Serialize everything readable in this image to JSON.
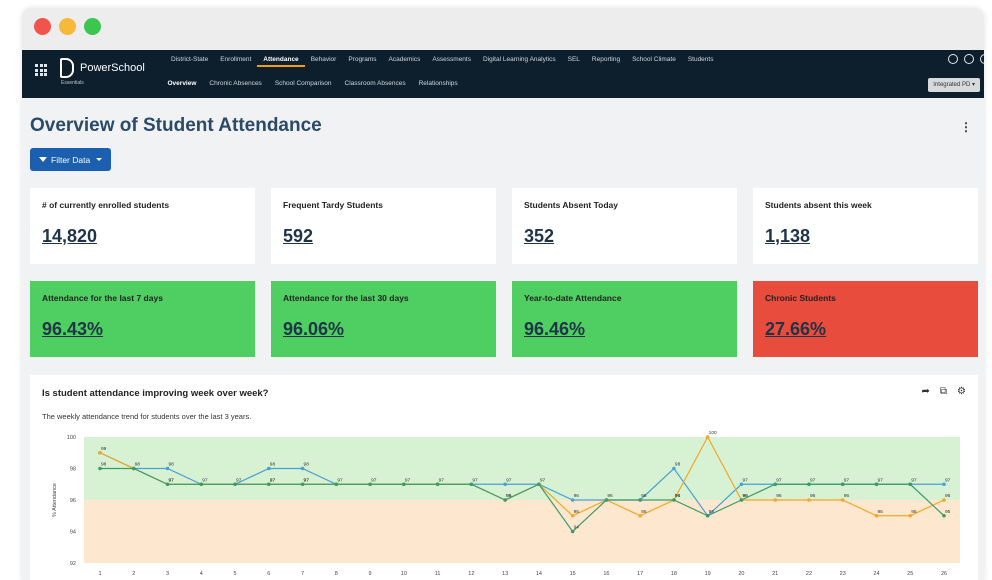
{
  "window": {
    "controls": [
      "close",
      "minimize",
      "maximize"
    ]
  },
  "brand": {
    "name": "PowerSchool",
    "sub": "Essentials"
  },
  "topnav": [
    "District-State",
    "Enrollment",
    "Attendance",
    "Behavior",
    "Programs",
    "Academics",
    "Assessments",
    "Digital Learning Analytics",
    "SEL",
    "Reporting",
    "School Climate",
    "Students"
  ],
  "topnav_active": "Attendance",
  "subnav": [
    "Overview",
    "Chronic Absences",
    "School Comparison",
    "Classroom Absences",
    "Relationships"
  ],
  "subnav_active": "Overview",
  "district_select": "Integrated PD ▾",
  "page": {
    "title": "Overview of Student Attendance",
    "filter_label": "Filter Data"
  },
  "stats": [
    {
      "label": "# of currently enrolled students",
      "value": "14,820"
    },
    {
      "label": "Frequent Tardy Students",
      "value": "592"
    },
    {
      "label": "Students Absent Today",
      "value": "352"
    },
    {
      "label": "Students absent this week",
      "value": "1,138"
    }
  ],
  "rates": [
    {
      "label": "Attendance for the last 7 days",
      "value": "96.43%",
      "status": "green"
    },
    {
      "label": "Attendance for the last 30 days",
      "value": "96.06%",
      "status": "green"
    },
    {
      "label": "Year-to-date Attendance",
      "value": "96.46%",
      "status": "green"
    },
    {
      "label": "Chronic Students",
      "value": "27.66%",
      "status": "red"
    }
  ],
  "colors": {
    "green_card": "#4fcf61",
    "red_card": "#e74c3c",
    "nav_bg": "#0d1f2d",
    "accent": "#f39c12",
    "button": "#1b5fae"
  },
  "chart": {
    "title": "Is student attendance improving week over week?",
    "subtitle": "The weekly attendance trend for students over the last 3 years.",
    "tools": [
      "share-icon",
      "external-link-icon",
      "settings-icon"
    ]
  },
  "chart_data": {
    "type": "line",
    "ylabel": "% Attendance",
    "ylim": [
      92,
      100
    ],
    "yticks": [
      92,
      94,
      96,
      98,
      100
    ],
    "x": [
      1,
      2,
      3,
      4,
      5,
      6,
      7,
      8,
      9,
      10,
      11,
      12,
      13,
      14,
      15,
      16,
      17,
      18,
      19,
      20,
      21,
      22,
      23,
      24,
      25,
      26
    ],
    "bands": [
      {
        "from": 96,
        "to": 100,
        "color": "#d6f2d3"
      },
      {
        "from": 92,
        "to": 96,
        "color": "#fde8cf"
      }
    ],
    "series": [
      {
        "color": "#4a9fd4",
        "values": [
          99,
          98,
          98,
          97,
          97,
          98,
          98,
          97,
          97,
          97,
          97,
          97,
          97,
          97,
          96,
          96,
          96,
          98,
          95,
          97,
          97,
          97,
          97,
          97,
          97,
          97
        ]
      },
      {
        "color": "#f5a623",
        "values": [
          99,
          98,
          97,
          97,
          97,
          97,
          97,
          97,
          97,
          97,
          97,
          97,
          96,
          97,
          95,
          96,
          95,
          96,
          100,
          96,
          96,
          96,
          96,
          95,
          95,
          96
        ]
      },
      {
        "color": "#3e9a66",
        "values": [
          98,
          98,
          97,
          97,
          97,
          97,
          97,
          97,
          97,
          97,
          97,
          97,
          96,
          97,
          94,
          96,
          96,
          96,
          95,
          96,
          97,
          97,
          97,
          97,
          97,
          95
        ]
      }
    ]
  }
}
